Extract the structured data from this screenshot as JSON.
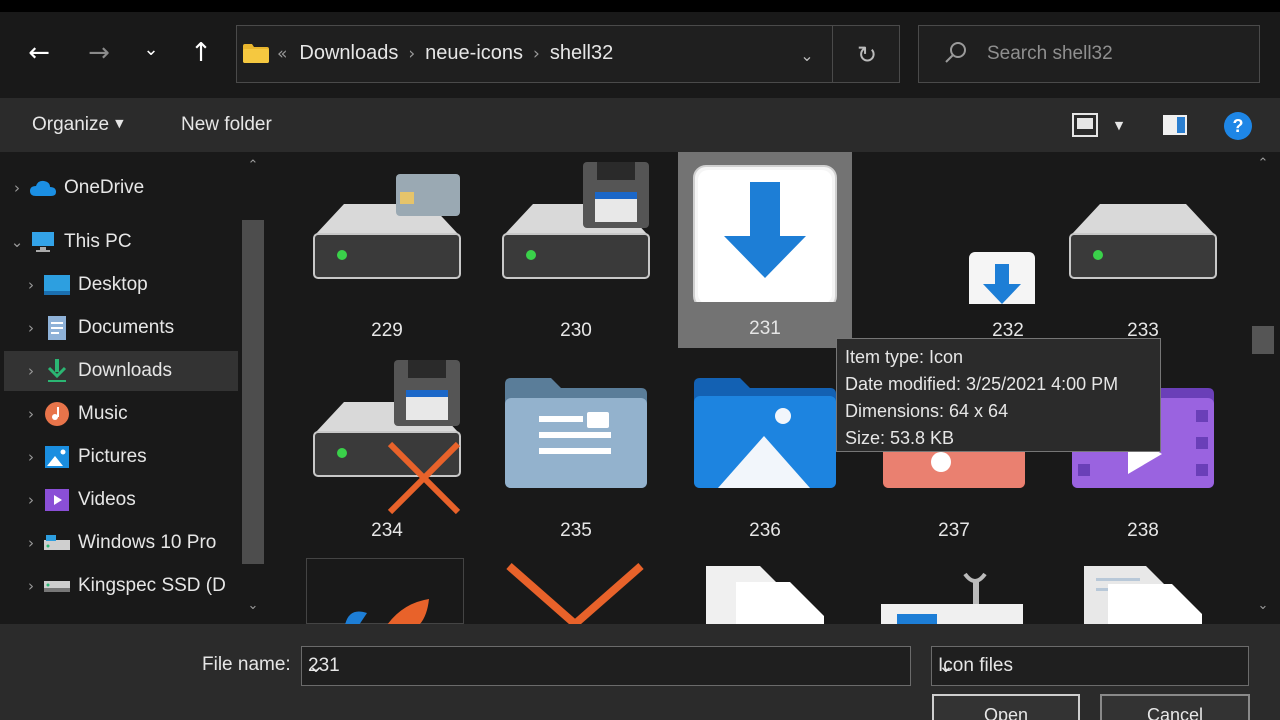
{
  "window": {
    "nav_pane_items_count": 10
  },
  "nav": {
    "back_icon": "←",
    "forward_icon": "→",
    "recent_icon": "⌄",
    "up_icon": "↑"
  },
  "address": {
    "overflow": "«",
    "crumbs": [
      "Downloads",
      "neue-icons",
      "shell32"
    ],
    "sep": "›",
    "dropdown_icon": "⌄",
    "refresh_icon": "↻"
  },
  "search": {
    "placeholder": "Search shell32"
  },
  "toolbar": {
    "organize": "Organize",
    "new_folder": "New folder",
    "help": "?"
  },
  "sidebar": {
    "items": [
      {
        "label": "OneDrive",
        "icon": "cloud-icon"
      },
      {
        "label": "This PC",
        "icon": "monitor-icon"
      },
      {
        "label": "Desktop",
        "icon": "desktop-icon"
      },
      {
        "label": "Documents",
        "icon": "documents-icon"
      },
      {
        "label": "Downloads",
        "icon": "download-arrow-icon"
      },
      {
        "label": "Music",
        "icon": "music-icon"
      },
      {
        "label": "Pictures",
        "icon": "pictures-icon"
      },
      {
        "label": "Videos",
        "icon": "videos-icon"
      },
      {
        "label": "Windows 10 Pro",
        "icon": "drive-icon"
      },
      {
        "label": "Kingspec SSD (D",
        "icon": "drive-icon"
      }
    ]
  },
  "files": [
    {
      "name": "229",
      "icon": "drive-sim-card-icon"
    },
    {
      "name": "230",
      "icon": "drive-floppy-icon"
    },
    {
      "name": "231",
      "icon": "download-large-icon"
    },
    {
      "name": "232",
      "icon": "download-small-icon"
    },
    {
      "name": "233",
      "icon": "drive-icon"
    },
    {
      "name": "234",
      "icon": "drive-floppy-error-icon"
    },
    {
      "name": "235",
      "icon": "contact-folder-icon"
    },
    {
      "name": "236",
      "icon": "pictures-folder-icon"
    },
    {
      "name": "237",
      "icon": "music-folder-icon"
    },
    {
      "name": "238",
      "icon": "videos-folder-icon"
    }
  ],
  "tooltip": {
    "type": "Item type: Icon",
    "modified": "Date modified: 3/25/2021 4:00 PM",
    "dimensions": "Dimensions: 64 x 64",
    "size": "Size: 53.8 KB"
  },
  "footer": {
    "file_name_label": "File name:",
    "file_name_value": "231",
    "file_type_value": "Icon files",
    "open_label": "Open",
    "cancel_label": "Cancel"
  },
  "colors": {
    "accent": "#1e86e6",
    "selected_tile": "#737373",
    "background": "#191919"
  }
}
